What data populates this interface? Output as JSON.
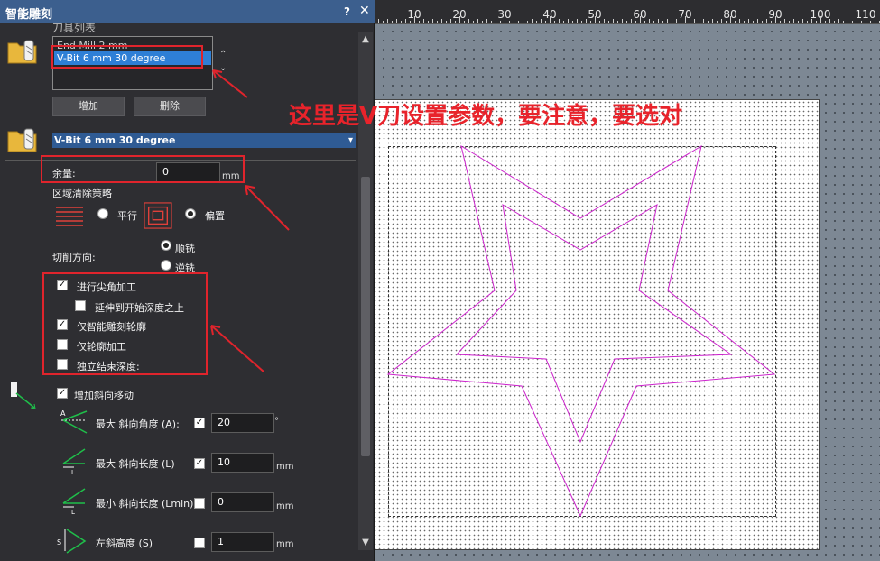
{
  "panel": {
    "title": "智能雕刻",
    "help_label": "?",
    "close_label": "✕"
  },
  "ruler": {
    "labels": [
      "10",
      "20",
      "30",
      "40",
      "50",
      "60",
      "70",
      "80",
      "90",
      "100",
      "110"
    ]
  },
  "tool_list": {
    "header": "刀具列表",
    "items": [
      "End Mill 2 mm",
      "V-Bit 6 mm 30 degree"
    ],
    "selected_index": 1,
    "add_label": "增加",
    "delete_label": "删除"
  },
  "selected_tool": {
    "name": "V-Bit 6 mm 30 degree"
  },
  "allowance": {
    "label": "余量:",
    "value": "0",
    "unit": "mm"
  },
  "clear_strategy": {
    "label": "区域清除策略",
    "option_parallel": "平行",
    "option_offset": "偏置",
    "selected": "偏置"
  },
  "cut_direction": {
    "label": "切削方向:",
    "option_climb": "顺铣",
    "option_conventional": "逆铣",
    "selected": "顺铣"
  },
  "options": {
    "corner_sharpening": {
      "label": "进行尖角加工",
      "checked": true
    },
    "extend_above_start": {
      "label": "延伸到开始深度之上",
      "checked": false
    },
    "smart_carve_outline": {
      "label": "仅智能雕刻轮廓",
      "checked": true
    },
    "outline_only": {
      "label": "仅轮廓加工",
      "checked": false
    },
    "independent_end_depth": {
      "label": "独立结束深度:",
      "checked": false
    }
  },
  "ramp": {
    "label": "增加斜向移动",
    "checked": true,
    "max_angle": {
      "label": "最大 斜向角度 (A):",
      "checked": true,
      "value": "20",
      "unit": "°"
    },
    "max_length": {
      "label": "最大 斜向长度 (L)",
      "checked": true,
      "value": "10",
      "unit": "mm"
    },
    "min_length": {
      "label": "最小 斜向长度 (Lmin)",
      "checked": false,
      "value": "0",
      "unit": "mm"
    },
    "left_height": {
      "label": "左斜高度 (S)",
      "checked": false,
      "value": "1",
      "unit": "mm"
    }
  },
  "annotation": {
    "text": "这里是V刀设置参数，要注意，要选对",
    "color": "#e8232b"
  },
  "colors": {
    "title_bar": "#3c5f8e",
    "selection": "#2e7fd6",
    "toolpath": "#cc22cc",
    "annotation_red": "#e0242c"
  }
}
